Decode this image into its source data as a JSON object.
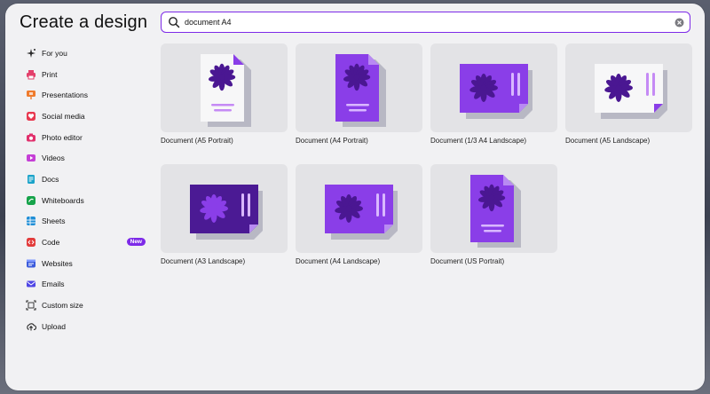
{
  "title": "Create a design",
  "search": {
    "value": "document A4",
    "placeholder": "Search"
  },
  "sidebar": {
    "items": [
      {
        "label": "For you",
        "icon": "sparkle-icon",
        "color": "#2a2a2a"
      },
      {
        "label": "Print",
        "icon": "printer-icon",
        "color": "#e3406b"
      },
      {
        "label": "Presentations",
        "icon": "presentation-icon",
        "color": "#ef7b2c"
      },
      {
        "label": "Social media",
        "icon": "heart-icon",
        "color": "#e8384f"
      },
      {
        "label": "Photo editor",
        "icon": "camera-icon",
        "color": "#e1306c"
      },
      {
        "label": "Videos",
        "icon": "video-icon",
        "color": "#c53fd6"
      },
      {
        "label": "Docs",
        "icon": "docs-icon",
        "color": "#1aa3c9"
      },
      {
        "label": "Whiteboards",
        "icon": "whiteboard-icon",
        "color": "#16a34a"
      },
      {
        "label": "Sheets",
        "icon": "sheets-icon",
        "color": "#1f8ed6"
      },
      {
        "label": "Code",
        "icon": "code-icon",
        "color": "#e23b3b",
        "badge": "New"
      },
      {
        "label": "Websites",
        "icon": "website-icon",
        "color": "#3b5bdb"
      },
      {
        "label": "Emails",
        "icon": "email-icon",
        "color": "#4f46e5"
      },
      {
        "label": "Custom size",
        "icon": "custom-size-icon",
        "color": "#2a2a2a"
      },
      {
        "label": "Upload",
        "icon": "upload-icon",
        "color": "#2a2a2a"
      }
    ]
  },
  "results": [
    {
      "label": "Document (A5 Portrait)",
      "thumb": "portrait-light"
    },
    {
      "label": "Document (A4 Portrait)",
      "thumb": "portrait-purple"
    },
    {
      "label": "Document (1/3 A4 Landscape)",
      "thumb": "landscape-purple"
    },
    {
      "label": "Document (A5 Landscape)",
      "thumb": "landscape-light"
    },
    {
      "label": "Document (A3 Landscape)",
      "thumb": "landscape-dark"
    },
    {
      "label": "Document (A4 Landscape)",
      "thumb": "landscape-purple"
    },
    {
      "label": "Document (US Portrait)",
      "thumb": "portrait-purple"
    }
  ],
  "colors": {
    "accent": "#7d2ae8",
    "flower_dark": "#4a1792",
    "doc_purple": "#8a3ee8",
    "doc_dark": "#4b1a94",
    "shadow": "#b8b8c4"
  }
}
